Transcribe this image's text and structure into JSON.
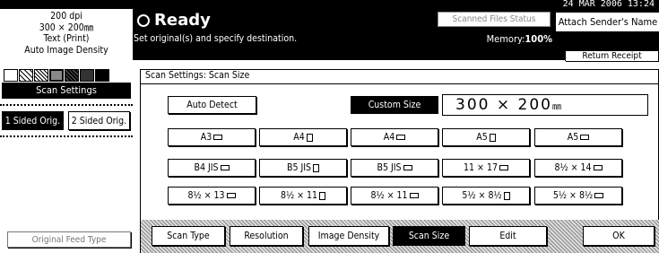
{
  "status": {
    "datetime": "24 MAR  2006 13:24"
  },
  "left_panel": {
    "resolution": "200 dpi",
    "size": "300 × 200㎜",
    "mode": "Text (Print)",
    "density": "Auto Image Density",
    "scan_settings": "Scan Settings",
    "orig_sided_1": "1 Sided Orig.",
    "orig_sided_2": "2 Sided Orig.",
    "orig_feed": "Original Feed Type"
  },
  "header": {
    "ready": "Ready",
    "subtitle": "Set original(s) and specify destination.",
    "scanned_files": "Scanned Files Status",
    "memory_label": "Memory:",
    "memory_value": "100%",
    "attach_sender": "Attach Sender's Name",
    "return_receipt": "Return Receipt"
  },
  "dialog": {
    "title": "Scan Settings: Scan Size",
    "auto_detect": "Auto Detect",
    "custom_size": "Custom Size",
    "custom_dims": "300 × 200",
    "custom_unit": "㎜",
    "row1": [
      "A3",
      "A4",
      "A4",
      "A5",
      "A5"
    ],
    "row2": [
      "B4 JIS",
      "B5 JIS",
      "B5 JIS",
      "11 × 17",
      "8½ × 14"
    ],
    "row3": [
      "8½ × 13",
      "8½ × 11",
      "8½ × 11",
      "5½ × 8½",
      "5½ × 8½"
    ],
    "tabs": {
      "scan_type": "Scan Type",
      "resolution": "Resolution",
      "image_density": "Image Density",
      "scan_size": "Scan Size",
      "edit": "Edit",
      "ok": "OK"
    }
  }
}
